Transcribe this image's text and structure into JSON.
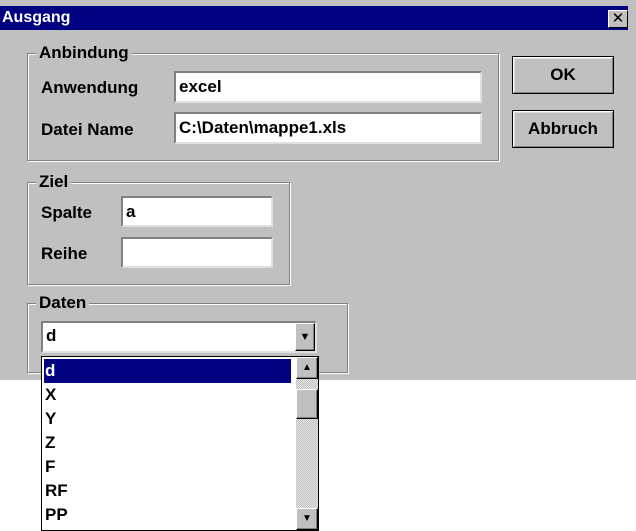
{
  "window": {
    "title": "Ausgang",
    "close_glyph": "✕"
  },
  "anbindung": {
    "group_title": "Anbindung",
    "anwendung_label": "Anwendung",
    "anwendung_value": "excel",
    "datei_name_label": "Datei Name",
    "datei_name_value": "C:\\Daten\\mappe1.xls"
  },
  "ziel": {
    "group_title": "Ziel",
    "spalte_label": "Spalte",
    "spalte_value": "a",
    "reihe_label": "Reihe",
    "reihe_value": ""
  },
  "daten": {
    "group_title": "Daten",
    "selected_value": "d",
    "options": [
      "d",
      "X",
      "Y",
      "Z",
      "F",
      "RF",
      "PP"
    ]
  },
  "buttons": {
    "ok_label": "OK",
    "cancel_label": "Abbruch"
  },
  "icons": {
    "dropdown_arrow": "chevron-down-icon",
    "scroll_up": "arrow-up-icon",
    "scroll_down": "arrow-down-icon",
    "close": "close-icon"
  }
}
